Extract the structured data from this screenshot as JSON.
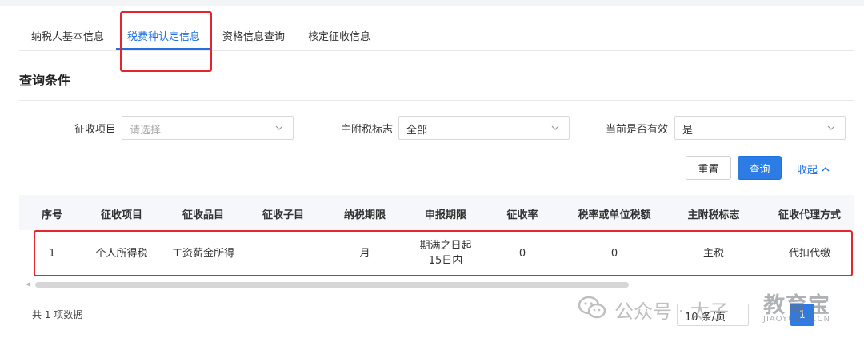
{
  "tabs": [
    {
      "label": "纳税人基本信息"
    },
    {
      "label": "税费种认定信息",
      "active": true
    },
    {
      "label": "资格信息查询"
    },
    {
      "label": "核定征收信息"
    }
  ],
  "section_title": "查询条件",
  "filters": {
    "item": {
      "label": "征收项目",
      "placeholder": "请选择"
    },
    "main_tax_flag": {
      "label": "主附税标志",
      "value": "全部"
    },
    "is_valid": {
      "label": "当前是否有效",
      "value": "是"
    }
  },
  "buttons": {
    "reset": "重置",
    "query": "查询",
    "collapse": "收起"
  },
  "table": {
    "columns": [
      "序号",
      "征收项目",
      "征收品目",
      "征收子目",
      "纳税期限",
      "申报期限",
      "征收率",
      "税率或单位税额",
      "主附税标志",
      "征收代理方式"
    ],
    "rows": [
      {
        "index": "1",
        "item": "个人所得税",
        "category": "工资薪金所得",
        "subcategory": "",
        "tax_period": "月",
        "declare_line1": "期满之日起",
        "declare_line2": "15日内",
        "levy_rate": "0",
        "tax_rate": "0",
        "main_flag": "主税",
        "agent_method": "代扣代缴"
      }
    ]
  },
  "footer": {
    "total": "共 1 项数据",
    "page_size": "10 条/页",
    "current_page": "1"
  },
  "watermark": {
    "text": "公众号 · 太子",
    "logo": "教育宝",
    "logo_sub": "JIAOYUBAO.CN"
  },
  "colors": {
    "accent": "#1f6fe5",
    "highlight": "#e3262d"
  }
}
